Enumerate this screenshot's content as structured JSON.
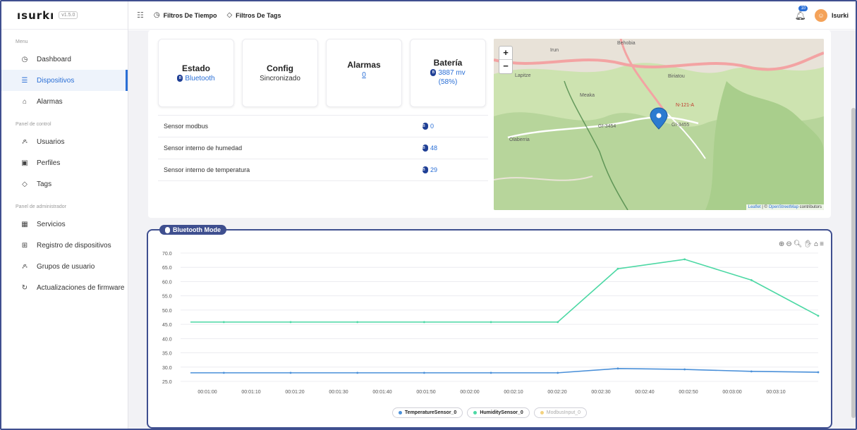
{
  "app": {
    "logo": "ısurkı",
    "version": "v1.5.0"
  },
  "sidebar": {
    "section_menu": "Menu",
    "section_control": "Panel de control",
    "section_admin": "Panel de administrador",
    "items": [
      {
        "label": "Dashboard",
        "icon": "dashboard-icon"
      },
      {
        "label": "Dispositivos",
        "icon": "list-icon"
      },
      {
        "label": "Alarmas",
        "icon": "alarm-icon"
      },
      {
        "label": "Usuarios",
        "icon": "user-icon"
      },
      {
        "label": "Perfiles",
        "icon": "profile-icon"
      },
      {
        "label": "Tags",
        "icon": "tag-icon"
      },
      {
        "label": "Servicios",
        "icon": "services-icon"
      },
      {
        "label": "Registro de dispositivos",
        "icon": "register-icon"
      },
      {
        "label": "Grupos de usuario",
        "icon": "group-icon"
      },
      {
        "label": "Actualizaciones de firmware",
        "icon": "refresh-icon"
      }
    ]
  },
  "topbar": {
    "filter_time": "Filtros De Tiempo",
    "filter_tags": "Filtros De Tags",
    "notifications": "10",
    "user": "Isurki"
  },
  "stats": {
    "estado_title": "Estado",
    "estado_value": "Bluetooth",
    "config_title": "Config",
    "config_value": "Sincronizado",
    "alarmas_title": "Alarmas",
    "alarmas_value": "0",
    "bateria_title": "Batería",
    "bateria_value": "3887 mv",
    "bateria_pct": "(58%)"
  },
  "sensors": [
    {
      "name": "Sensor modbus",
      "value": "0"
    },
    {
      "name": "Sensor interno de humedad",
      "value": "48"
    },
    {
      "name": "Sensor interno de temperatura",
      "value": "29"
    }
  ],
  "map": {
    "zoom_in": "+",
    "zoom_out": "−",
    "attribution_leaflet": "Leaflet",
    "attribution_sep": " | © ",
    "attribution_osm": "OpenStreetMap",
    "attribution_tail": " contributors",
    "labels": [
      "Irun",
      "Behobia",
      "Lapitze",
      "Meaka",
      "Olaberria",
      "Biriatou",
      "N-121-A",
      "GI-3454",
      "GI-3455"
    ]
  },
  "chart": {
    "mode_label": "Bluetooth Mode",
    "toolbar_icons": [
      "zoom-in-icon",
      "zoom-out-icon",
      "magnify-icon",
      "pan-icon",
      "home-icon",
      "menu-icon"
    ]
  },
  "chart_data": {
    "type": "line",
    "x": [
      "00:01:00",
      "00:01:10",
      "00:01:20",
      "00:01:30",
      "00:01:40",
      "00:01:50",
      "00:02:00",
      "00:02:10",
      "00:02:20",
      "00:02:30",
      "00:02:40",
      "00:02:50",
      "00:03:00",
      "00:03:10"
    ],
    "ylim": [
      25,
      70
    ],
    "yticks": [
      "70.0",
      "65.0",
      "60.0",
      "55.0",
      "50.0",
      "45.0",
      "40.0",
      "35.0",
      "30.0",
      "25.0"
    ],
    "series": [
      {
        "name": "TemperatureSensor_0",
        "color": "#4a90d9",
        "points": [
          [
            -0.5,
            28
          ],
          [
            0,
            28
          ],
          [
            1,
            28
          ],
          [
            2,
            28
          ],
          [
            3,
            28
          ],
          [
            4,
            28
          ],
          [
            5,
            28
          ],
          [
            5.9,
            29.5
          ],
          [
            6.9,
            29.2
          ],
          [
            7.9,
            28.5
          ],
          [
            8.9,
            28.2
          ]
        ]
      },
      {
        "name": "HumiditySensor_0",
        "color": "#4cd8a4",
        "points": [
          [
            -0.5,
            45.8
          ],
          [
            0,
            45.8
          ],
          [
            1,
            45.8
          ],
          [
            2,
            45.8
          ],
          [
            3,
            45.8
          ],
          [
            4,
            45.8
          ],
          [
            5,
            45.8
          ],
          [
            5.9,
            64.5
          ],
          [
            6.9,
            67.8
          ],
          [
            7.9,
            60.5
          ],
          [
            8.9,
            48
          ]
        ]
      },
      {
        "name": "ModbusInput_0",
        "color": "#f3d27f",
        "hidden": true,
        "points": []
      }
    ],
    "grid": true,
    "legend": "bottom"
  }
}
